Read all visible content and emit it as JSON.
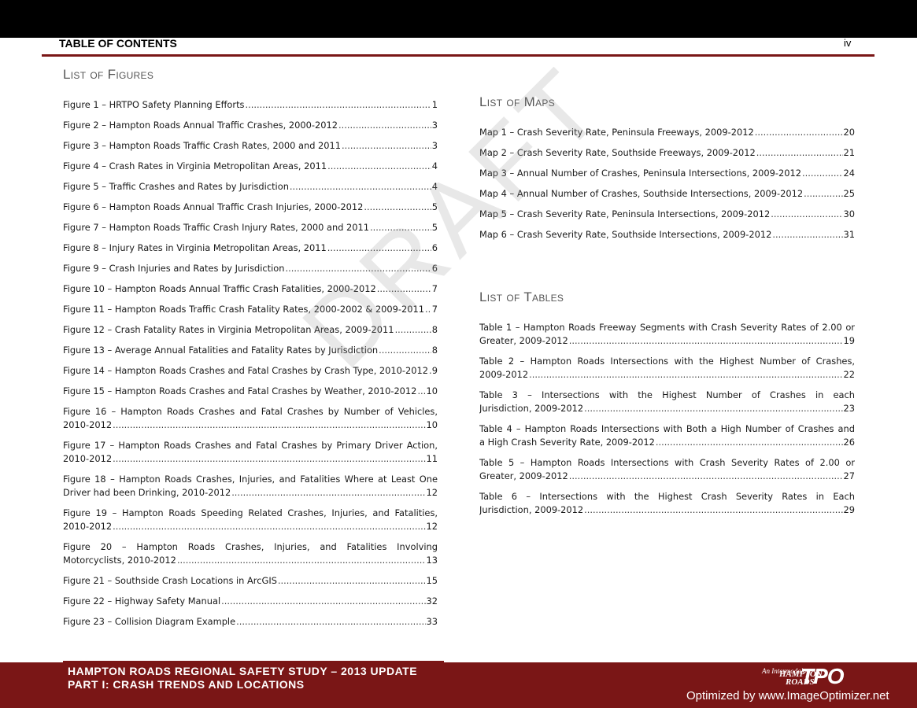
{
  "header": {
    "title": "TABLE OF CONTENTS",
    "page_number": "iv"
  },
  "figures": {
    "heading": "List of Figures",
    "items": [
      {
        "title": "Figure 1 – HRTPO Safety Planning Efforts",
        "page": "1"
      },
      {
        "title": "Figure 2 – Hampton Roads Annual Traffic Crashes, 2000-2012",
        "page": "3"
      },
      {
        "title": "Figure 3 – Hampton Roads Traffic Crash Rates, 2000 and 2011",
        "page": "3"
      },
      {
        "title": "Figure 4 – Crash Rates in Virginia Metropolitan Areas, 2011",
        "page": "4"
      },
      {
        "title": "Figure 5 – Traffic Crashes and Rates by Jurisdiction",
        "page": "4"
      },
      {
        "title": "Figure 6 – Hampton Roads Annual Traffic Crash Injuries, 2000-2012",
        "page": "5"
      },
      {
        "title": "Figure 7 – Hampton Roads Traffic Crash Injury Rates, 2000 and 2011",
        "page": "5"
      },
      {
        "title": "Figure 8 – Injury Rates in Virginia Metropolitan Areas, 2011",
        "page": "6"
      },
      {
        "title": "Figure 9 – Crash Injuries and Rates by Jurisdiction",
        "page": "6"
      },
      {
        "title": "Figure 10 – Hampton Roads Annual Traffic Crash Fatalities, 2000-2012",
        "page": "7"
      },
      {
        "title": "Figure 11 – Hampton Roads Traffic Crash Fatality Rates, 2000-2002 & 2009-2011",
        "page": "7"
      },
      {
        "title": "Figure 12 – Crash Fatality Rates in Virginia Metropolitan Areas, 2009-2011",
        "page": "8"
      },
      {
        "title": "Figure 13 – Average Annual Fatalities and Fatality Rates by Jurisdiction",
        "page": "8"
      },
      {
        "title": "Figure 14 – Hampton Roads Crashes and Fatal Crashes by Crash Type, 2010-2012",
        "page": "9"
      },
      {
        "title": "Figure 15 – Hampton Roads Crashes and Fatal Crashes by Weather, 2010-2012",
        "page": "10"
      }
    ],
    "multi": [
      {
        "line1": "Figure 16 – Hampton Roads Crashes and Fatal Crashes by Number of Vehicles,",
        "line2": "2010-2012",
        "page": "10"
      },
      {
        "line1": "Figure 17 – Hampton Roads Crashes and Fatal Crashes by Primary Driver Action,",
        "line2": "2010-2012",
        "page": "11"
      },
      {
        "line1": "Figure 18 – Hampton Roads Crashes, Injuries, and Fatalities Where at Least One",
        "line2": "Driver had been Drinking, 2010-2012",
        "page": "12"
      },
      {
        "line1": "Figure 19 – Hampton Roads Speeding Related Crashes, Injuries, and Fatalities,",
        "line2": "2010-2012",
        "page": "12"
      },
      {
        "line1": "Figure 20 – Hampton Roads Crashes, Injuries, and Fatalities Involving",
        "line2": "Motorcyclists, 2010-2012",
        "page": "13"
      }
    ],
    "tail": [
      {
        "title": "Figure 21 – Southside Crash Locations in ArcGIS",
        "page": "15"
      },
      {
        "title": "Figure 22 – Highway Safety Manual",
        "page": "32"
      },
      {
        "title": "Figure 23 – Collision Diagram Example",
        "page": "33"
      }
    ]
  },
  "maps": {
    "heading": "List of Maps",
    "items": [
      {
        "title": "Map 1 – Crash Severity Rate, Peninsula Freeways, 2009-2012",
        "page": "20"
      },
      {
        "title": "Map 2 – Crash Severity Rate, Southside Freeways, 2009-2012",
        "page": "21"
      },
      {
        "title": "Map 3 – Annual Number of Crashes, Peninsula Intersections, 2009-2012",
        "page": "24"
      },
      {
        "title": "Map 4 – Annual Number of Crashes, Southside Intersections, 2009-2012",
        "page": "25"
      },
      {
        "title": "Map 5 – Crash Severity Rate, Peninsula Intersections, 2009-2012",
        "page": "30"
      },
      {
        "title": "Map 6 – Crash Severity Rate, Southside Intersections, 2009-2012",
        "page": "31"
      }
    ]
  },
  "tables": {
    "heading": "List of Tables",
    "items": [
      {
        "line1": "Table 1 – Hampton Roads Freeway Segments with Crash Severity Rates of 2.00 or",
        "line2": "Greater, 2009-2012",
        "page": "19"
      },
      {
        "line1": "Table 2 – Hampton Roads Intersections with the Highest Number of Crashes,",
        "line2": "2009-2012",
        "page": "22"
      },
      {
        "line1": "Table 3 – Intersections with the Highest Number of Crashes in each",
        "line2": "Jurisdiction, 2009-2012",
        "page": "23"
      },
      {
        "line1": "Table 4 – Hampton Roads Intersections with Both a High Number of Crashes and",
        "line2": "a High Crash Severity Rate, 2009-2012",
        "page": "26"
      },
      {
        "line1": "Table 5 – Hampton Roads Intersections with Crash Severity Rates of 2.00 or",
        "line2": "Greater, 2009-2012",
        "page": "27"
      },
      {
        "line1": "Table 6 – Intersections with the Highest Crash Severity Rates in Each",
        "line2": "Jurisdiction, 2009-2012",
        "page": "29"
      }
    ]
  },
  "watermark": "DRAFT",
  "footer": {
    "line1": "HAMPTON ROADS REGIONAL SAFETY STUDY – 2013 UPDATE",
    "line2": "PART I: CRASH TRENDS AND LOCATIONS",
    "logo_top": "An Intermodal",
    "logo_hampton": "HAMPTON",
    "logo_roads": "ROADS",
    "logo_tpo": "TPO",
    "optimizer": "Optimized by www.ImageOptimizer.net"
  }
}
